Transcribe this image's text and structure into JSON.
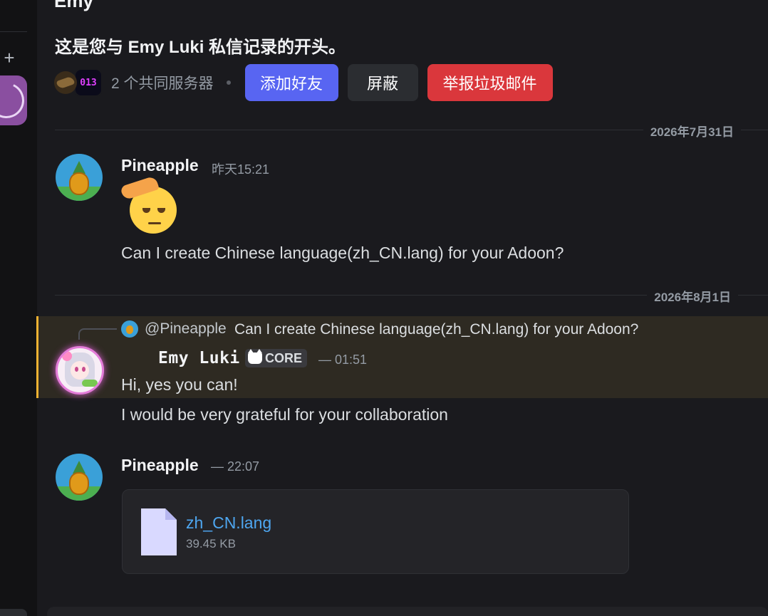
{
  "header": {
    "title_partial": "Emy"
  },
  "intro": {
    "text": "这是您与 Emy Luki 私信记录的开头。",
    "mutual_servers": "2 个共同服务器",
    "server_badge": "013",
    "buttons": {
      "add_friend": "添加好友",
      "block": "屏蔽",
      "report": "举报垃圾邮件"
    }
  },
  "dates": {
    "first": "2026年7月31日",
    "second": "2026年8月1日"
  },
  "messages": [
    {
      "author": "Pineapple",
      "time": "昨天15:21",
      "emoji": "saluting-face",
      "text": "Can I create Chinese language(zh_CN.lang) for your Adoon?"
    },
    {
      "reply_author": "@Pineapple",
      "reply_text": "Can I create Chinese language(zh_CN.lang) for your Adoon?",
      "author": "Emy Luki",
      "tag": "CORE",
      "time": "— 01:51",
      "lines": [
        "Hi, yes you can!",
        "I would be very grateful for your collaboration"
      ]
    },
    {
      "author": "Pineapple",
      "time": "— 22:07",
      "attachment": {
        "name": "zh_CN.lang",
        "size": "39.45 KB"
      }
    }
  ],
  "colors": {
    "accent": "#5865f2",
    "danger": "#da373c",
    "mention": "#f0b232",
    "link": "#4ea6f0"
  }
}
